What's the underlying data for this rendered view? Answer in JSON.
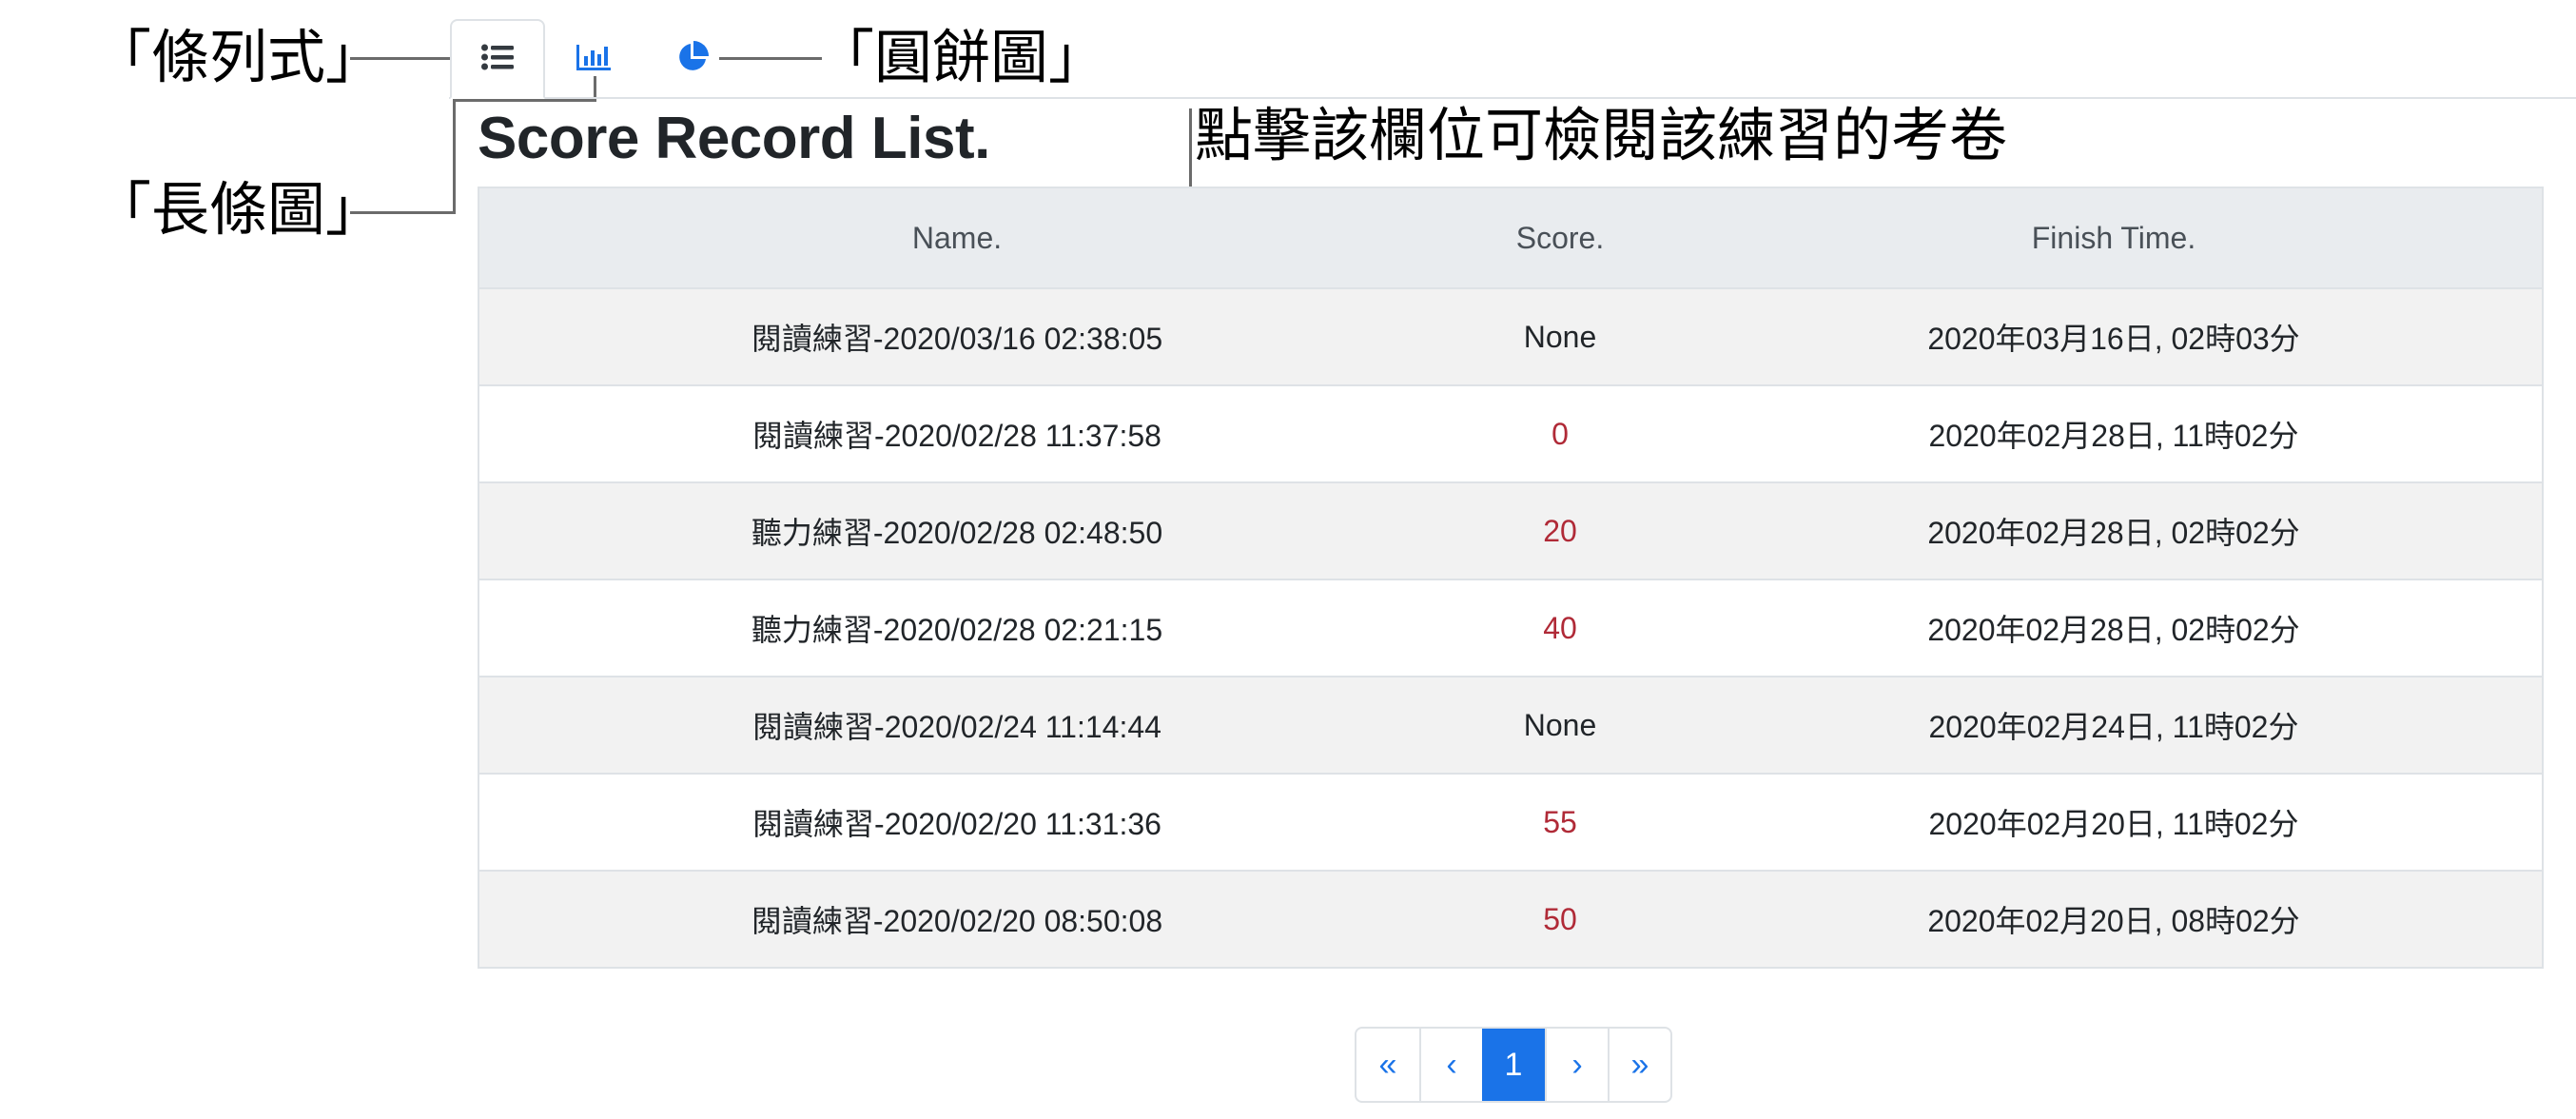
{
  "annotations": {
    "list_label": "「條列式」",
    "bar_label": "「長條圖」",
    "pie_label": "「圓餅圖」",
    "click_hint": "點擊該欄位可檢閱該練習的考卷"
  },
  "tabs": [
    {
      "name": "list",
      "icon": "list-icon",
      "active": true
    },
    {
      "name": "bar",
      "icon": "bar-chart-icon",
      "active": false
    },
    {
      "name": "pie",
      "icon": "pie-chart-icon",
      "active": false
    }
  ],
  "title": "Score Record List.",
  "table": {
    "headers": [
      "Name.",
      "Score.",
      "Finish Time."
    ],
    "rows": [
      {
        "name": "閱讀練習-2020/03/16 02:38:05",
        "score": "None",
        "time": "2020年03月16日, 02時03分"
      },
      {
        "name": "閱讀練習-2020/02/28 11:37:58",
        "score": "0",
        "time": "2020年02月28日, 11時02分"
      },
      {
        "name": "聽力練習-2020/02/28 02:48:50",
        "score": "20",
        "time": "2020年02月28日, 02時02分"
      },
      {
        "name": "聽力練習-2020/02/28 02:21:15",
        "score": "40",
        "time": "2020年02月28日, 02時02分"
      },
      {
        "name": "閱讀練習-2020/02/24 11:14:44",
        "score": "None",
        "time": "2020年02月24日, 11時02分"
      },
      {
        "name": "閱讀練習-2020/02/20 11:31:36",
        "score": "55",
        "time": "2020年02月20日, 11時02分"
      },
      {
        "name": "閱讀練習-2020/02/20 08:50:08",
        "score": "50",
        "time": "2020年02月20日, 08時02分"
      }
    ]
  },
  "pagination": {
    "first": "«",
    "prev": "‹",
    "current": "1",
    "next": "›",
    "last": "»"
  },
  "colors": {
    "accent": "#1a73e8",
    "score_red": "#b02a37",
    "header_bg": "#e9ecef",
    "stripe": "#f2f2f2"
  }
}
